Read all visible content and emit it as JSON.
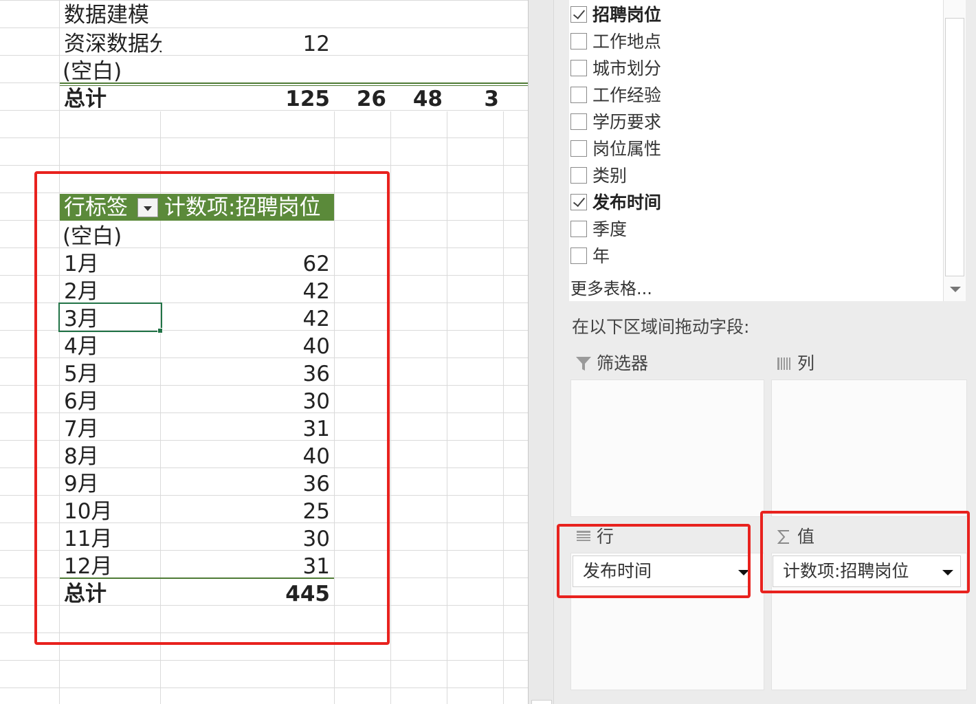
{
  "sheet": {
    "top_rows": [
      {
        "label": "数据建模",
        "v1": "",
        "v2": "",
        "v3": "",
        "v4": ""
      },
      {
        "label": "资深数据分",
        "v1": "12",
        "v2": "",
        "v3": "",
        "v4": ""
      },
      {
        "label": "(空白)",
        "v1": "",
        "v2": "",
        "v3": "",
        "v4": ""
      }
    ],
    "top_total": {
      "label": "总计",
      "v1": "125",
      "v2": "26",
      "v3": "48",
      "v4": "3"
    },
    "pivot": {
      "row_header": "行标签",
      "value_header": "计数项:招聘岗位",
      "rows": [
        {
          "label": "(空白)",
          "value": ""
        },
        {
          "label": "1月",
          "value": "62"
        },
        {
          "label": "2月",
          "value": "42"
        },
        {
          "label": "3月",
          "value": "42"
        },
        {
          "label": "4月",
          "value": "40"
        },
        {
          "label": "5月",
          "value": "36"
        },
        {
          "label": "6月",
          "value": "30"
        },
        {
          "label": "7月",
          "value": "31"
        },
        {
          "label": "8月",
          "value": "40"
        },
        {
          "label": "9月",
          "value": "36"
        },
        {
          "label": "10月",
          "value": "25"
        },
        {
          "label": "11月",
          "value": "30"
        },
        {
          "label": "12月",
          "value": "31"
        }
      ],
      "total": {
        "label": "总计",
        "value": "445"
      }
    }
  },
  "panel": {
    "fields": [
      {
        "label": "招聘岗位",
        "checked": true
      },
      {
        "label": "工作地点",
        "checked": false
      },
      {
        "label": "城市划分",
        "checked": false
      },
      {
        "label": "工作经验",
        "checked": false
      },
      {
        "label": "学历要求",
        "checked": false
      },
      {
        "label": "岗位属性",
        "checked": false
      },
      {
        "label": "类别",
        "checked": false
      },
      {
        "label": "发布时间",
        "checked": true
      },
      {
        "label": "季度",
        "checked": false
      },
      {
        "label": "年",
        "checked": false
      }
    ],
    "more_tables": "更多表格...",
    "drag_hint": "在以下区域间拖动字段:",
    "areas": {
      "filters": {
        "title": "筛选器",
        "icon": "filter-icon"
      },
      "columns": {
        "title": "列",
        "icon": "columns-icon"
      },
      "rows": {
        "title": "行",
        "icon": "rows-icon",
        "field": "发布时间"
      },
      "values": {
        "title": "值",
        "icon": "sigma-icon",
        "field": "计数项:招聘岗位"
      }
    }
  },
  "colors": {
    "pivot_header_bg": "#5b8a3a",
    "highlight": "#e8221e",
    "selection": "#217346"
  }
}
